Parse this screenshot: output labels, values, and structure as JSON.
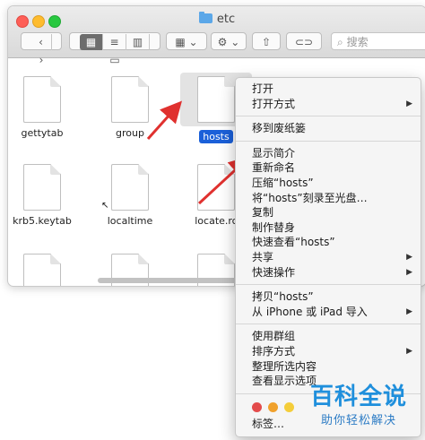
{
  "window": {
    "title": "etc"
  },
  "toolbar": {
    "back": "‹",
    "forward": "›",
    "view_icons": "▦",
    "view_list": "≡",
    "view_columns": "▥",
    "view_gallery": "▭",
    "group_icon": "▦",
    "group_chevron": "⌄",
    "action_icon": "⚙",
    "action_chevron": "⌄",
    "share_icon": "⇧",
    "tag_icon": "⊂⊃",
    "search_icon": "⌕",
    "search_placeholder": "搜索"
  },
  "files": [
    {
      "name": "gettytab"
    },
    {
      "name": "group"
    },
    {
      "name": "hosts"
    },
    {
      "name": "krb5.keytab"
    },
    {
      "name": "localtime"
    },
    {
      "name": "locate.rc"
    }
  ],
  "context_menu": {
    "group1": [
      {
        "label": "打开"
      },
      {
        "label": "打开方式",
        "has_submenu": true
      }
    ],
    "group2": [
      {
        "label": "移到废纸篓"
      }
    ],
    "group3": [
      {
        "label": "显示简介"
      },
      {
        "label": "重新命名"
      },
      {
        "label": "压缩“hosts”"
      },
      {
        "label": "将“hosts”刻录至光盘…"
      },
      {
        "label": "复制"
      },
      {
        "label": "制作替身"
      },
      {
        "label": "快速查看“hosts”"
      },
      {
        "label": "共享",
        "has_submenu": true
      },
      {
        "label": "快速操作",
        "has_submenu": true
      }
    ],
    "group4": [
      {
        "label": "拷贝“hosts”"
      },
      {
        "label": "从 iPhone 或 iPad 导入",
        "has_submenu": true
      }
    ],
    "group5": [
      {
        "label": "使用群组"
      },
      {
        "label": "排序方式",
        "has_submenu": true
      },
      {
        "label": "整理所选内容"
      },
      {
        "label": "查看显示选项"
      }
    ],
    "tag_colors": [
      "#e34b4b",
      "#f0a12c",
      "#f4cd3a"
    ],
    "tags_label": "标签…",
    "submenu_glyph": "▶"
  },
  "watermark": {
    "title": "百科全说",
    "subtitle": "助你轻松解决"
  },
  "colors": {
    "selection": "#1b60d9",
    "arrow": "#e0312f"
  }
}
